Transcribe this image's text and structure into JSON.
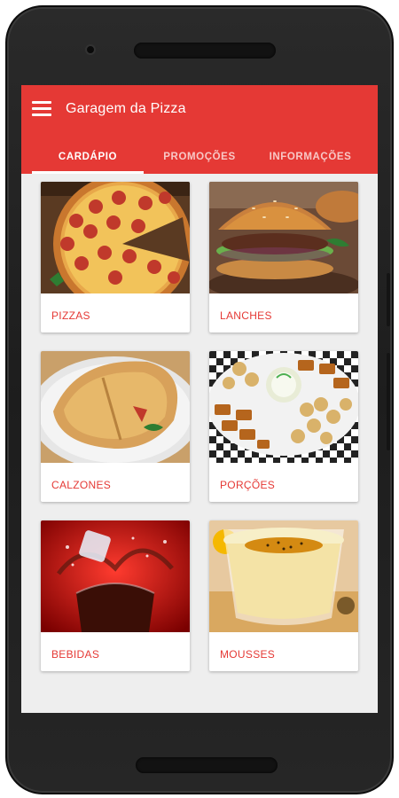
{
  "app": {
    "title": "Garagem da Pizza"
  },
  "tabs": [
    {
      "label": "CARDÁPIO",
      "active": true
    },
    {
      "label": "PROMOÇÕES",
      "active": false
    },
    {
      "label": "INFORMAÇÕES",
      "active": false
    }
  ],
  "categories": [
    {
      "label": "PIZZAS",
      "image": "pizza-image"
    },
    {
      "label": "LANCHES",
      "image": "burger-image"
    },
    {
      "label": "CALZONES",
      "image": "calzone-image"
    },
    {
      "label": "PORÇÕES",
      "image": "portions-image"
    },
    {
      "label": "BEBIDAS",
      "image": "soda-image"
    },
    {
      "label": "MOUSSES",
      "image": "mousse-image"
    }
  ],
  "colors": {
    "primary": "#e53935",
    "background": "#eeeeee",
    "card": "#ffffff"
  },
  "icons": {
    "menu": "menu-icon"
  }
}
